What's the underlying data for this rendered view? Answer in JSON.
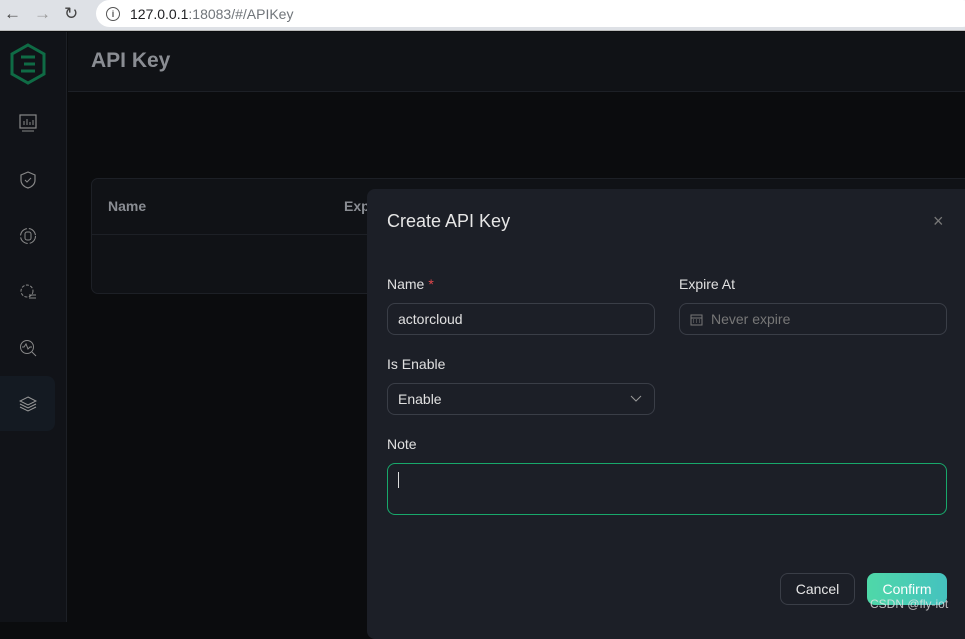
{
  "browser": {
    "url_host": "127.0.0.1",
    "url_path": ":18083/#/APIKey",
    "back": "←",
    "forward": "→",
    "reload": "↻"
  },
  "sidebar": {
    "items": [
      {
        "icon": "dashboard-icon"
      },
      {
        "icon": "shield-check-icon"
      },
      {
        "icon": "database-sync-icon"
      },
      {
        "icon": "gear-list-icon"
      },
      {
        "icon": "diagnose-icon"
      },
      {
        "icon": "layers-icon",
        "active": true
      }
    ]
  },
  "header": {
    "title": "API Key"
  },
  "table": {
    "columns": [
      "Name",
      "Exp"
    ]
  },
  "modal": {
    "title": "Create API Key",
    "close": "×",
    "name_label": "Name",
    "required_mark": "*",
    "name_value": "actorcloud",
    "expire_label": "Expire At",
    "expire_placeholder": "Never expire",
    "enable_label": "Is Enable",
    "enable_value": "Enable",
    "note_label": "Note",
    "cancel": "Cancel",
    "confirm": "Confirm"
  },
  "watermark": "CSDN @fly-iot",
  "colors": {
    "accent": "#18a86b",
    "confirm": "#4fd8a8"
  }
}
